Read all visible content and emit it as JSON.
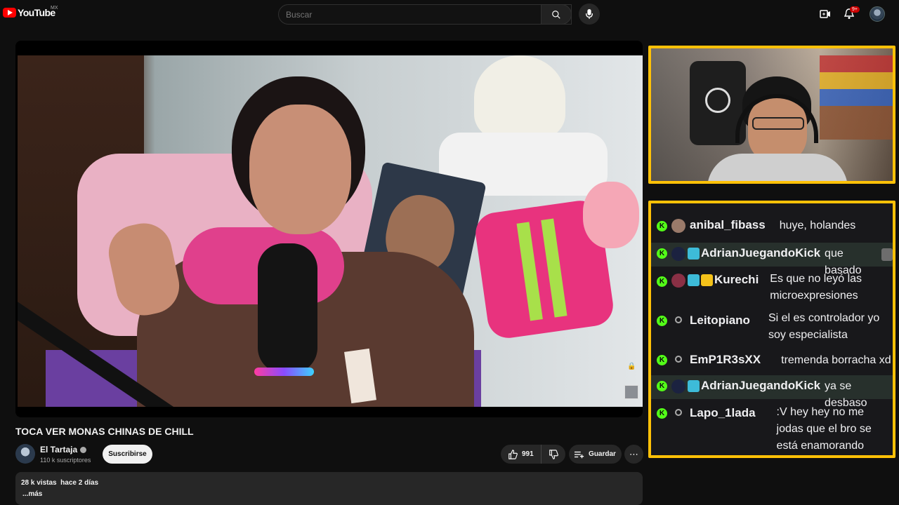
{
  "topbar": {
    "logo_text": "YouTube",
    "region": "MX",
    "search_placeholder": "Buscar",
    "notifications_badge": "9+"
  },
  "video": {
    "title": "TOCA VER MONAS CHINAS DE CHILL",
    "channel_name": "El Tartaja",
    "subscribers": "110 k suscriptores",
    "subscribe_label": "Suscribirse",
    "likes": "991",
    "save_label": "Guardar",
    "views": "28 k vistas",
    "date": "hace 2 días",
    "more_label": "...más",
    "stats_line": "28 k vistas  hace 2 días"
  },
  "chat": {
    "messages": [
      {
        "user": "anibal_fibass",
        "text": "huye, holandes",
        "highlight": false
      },
      {
        "user": "AdrianJuegandoKick",
        "text": "que basado",
        "highlight": true
      },
      {
        "user": "Kurechi",
        "text": "Es que no leyó las microexpresiones",
        "highlight": false
      },
      {
        "user": "Leitopiano",
        "text": "Si el es controlador yo soy especialista",
        "highlight": false
      },
      {
        "user": "EmP1R3sXX",
        "text": "tremenda borracha xd",
        "highlight": false
      },
      {
        "user": "AdrianJuegandoKick",
        "text": "ya se desbaso",
        "highlight": true
      },
      {
        "user": "Lapo_1lada",
        "text": ":V hey hey no me jodas que el bro se está enamorando",
        "highlight": false
      }
    ]
  },
  "colors": {
    "accent_frame": "#ffc107",
    "kick_green": "#53fc18",
    "yt_red": "#ff0000"
  }
}
